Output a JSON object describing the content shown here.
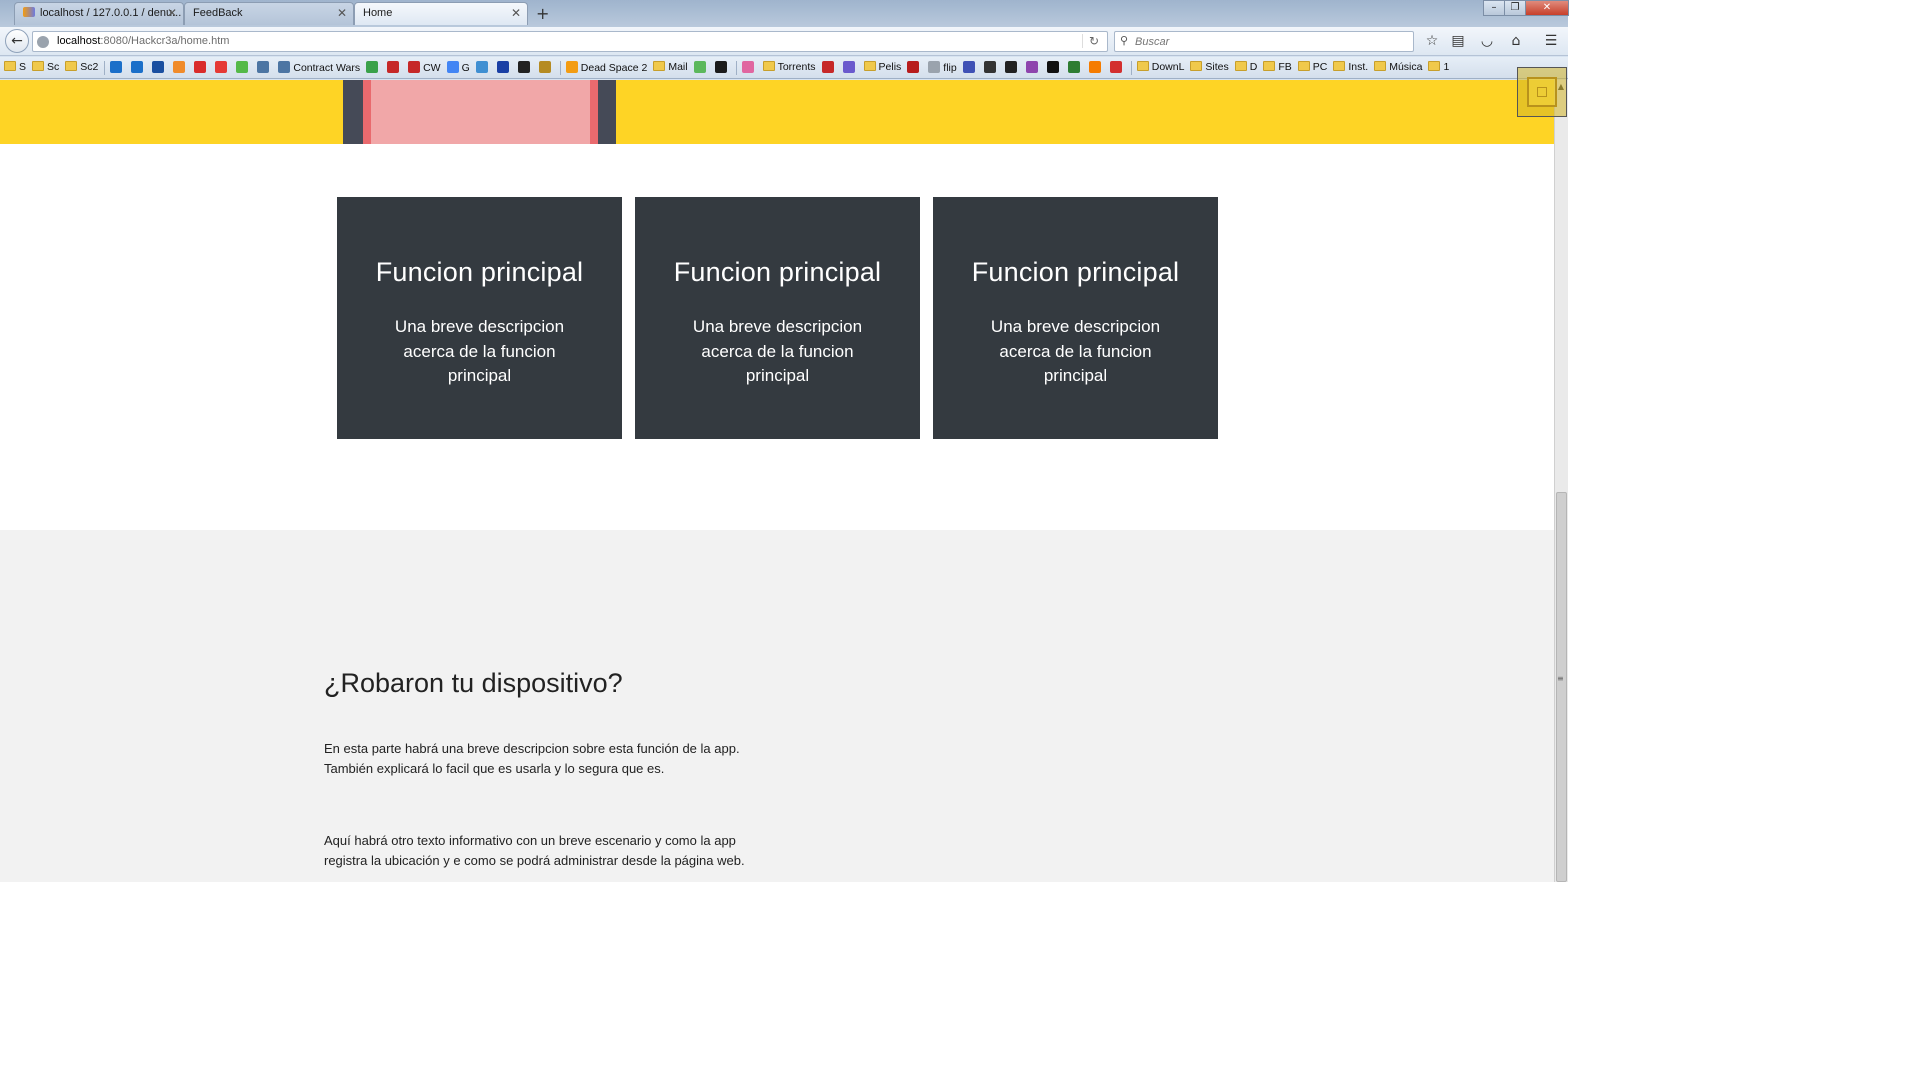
{
  "browser": {
    "tabs": [
      {
        "title": "localhost / 127.0.0.1 / denu...",
        "active": false
      },
      {
        "title": "FeedBack",
        "active": false
      },
      {
        "title": "Home",
        "active": true
      }
    ],
    "new_tab": "+",
    "window_controls": {
      "minimize": "–",
      "restore": "❐",
      "close": "✕"
    },
    "url": {
      "host": "localhost",
      "path": ":8080/Hackcr3a/home.htm"
    },
    "search_placeholder": "Buscar",
    "bookmarks": [
      {
        "label": "S",
        "kind": "folder"
      },
      {
        "label": "Sc",
        "kind": "folder"
      },
      {
        "label": "Sc2",
        "kind": "folder"
      },
      {
        "label": "",
        "kind": "sep"
      },
      {
        "label": "",
        "kind": "icon",
        "color": "#1b6fc9",
        "icon": "ti-icon"
      },
      {
        "label": "",
        "kind": "icon",
        "color": "#1b6fc9",
        "icon": "t-icon"
      },
      {
        "label": "",
        "kind": "icon",
        "color": "#1a4fa0",
        "icon": "d-icon"
      },
      {
        "label": "",
        "kind": "icon",
        "color": "#f08b2a",
        "icon": "cloud-icon"
      },
      {
        "label": "",
        "kind": "icon",
        "color": "#d92b2b",
        "icon": "youtube-icon"
      },
      {
        "label": "",
        "kind": "icon",
        "color": "#e53935",
        "icon": "cross-icon"
      },
      {
        "label": "",
        "kind": "icon",
        "color": "#54b948",
        "icon": "m-icon"
      },
      {
        "label": "",
        "kind": "icon",
        "color": "#4c75a3",
        "icon": "vk-icon"
      },
      {
        "label": "Contract Wars",
        "kind": "icon",
        "color": "#4c75a3",
        "icon": "vk-icon"
      },
      {
        "label": "",
        "kind": "icon",
        "color": "#3aa14a",
        "icon": "grid-icon"
      },
      {
        "label": "",
        "kind": "icon",
        "color": "#c62828",
        "icon": "k-icon"
      },
      {
        "label": "CW",
        "kind": "icon",
        "color": "#c62828",
        "icon": "k-icon"
      },
      {
        "label": "G",
        "kind": "icon",
        "color": "#4285f4",
        "icon": "google-icon"
      },
      {
        "label": "",
        "kind": "icon",
        "color": "#3f8fd2",
        "icon": "swirl-icon"
      },
      {
        "label": "",
        "kind": "icon",
        "color": "#1a3fa5",
        "icon": "s-icon"
      },
      {
        "label": "",
        "kind": "icon",
        "color": "#222222",
        "icon": "paw-icon"
      },
      {
        "label": "",
        "kind": "icon",
        "color": "#b58b22",
        "icon": "n-icon"
      },
      {
        "label": "",
        "kind": "sep"
      },
      {
        "label": "Dead Space 2",
        "kind": "icon",
        "color": "#f39c12",
        "icon": "info-icon"
      },
      {
        "label": "Mail",
        "kind": "folder"
      },
      {
        "label": "",
        "kind": "icon",
        "color": "#5cb85c",
        "icon": "m-icon"
      },
      {
        "label": "",
        "kind": "icon",
        "color": "#1b1b1b",
        "icon": "circle-icon"
      },
      {
        "label": "",
        "kind": "sep"
      },
      {
        "label": "",
        "kind": "icon",
        "color": "#e066a0",
        "icon": "flower-icon"
      },
      {
        "label": "Torrents",
        "kind": "folder"
      },
      {
        "label": "",
        "kind": "icon",
        "color": "#c62828",
        "icon": "z-icon"
      },
      {
        "label": "",
        "kind": "icon",
        "color": "#6a5acd",
        "icon": "hz-icon"
      },
      {
        "label": "Pelis",
        "kind": "folder"
      },
      {
        "label": "",
        "kind": "icon",
        "color": "#b71c1c",
        "icon": "poster-icon"
      },
      {
        "label": "flip",
        "kind": "icon",
        "color": "#9aa3ad",
        "icon": "globe-icon"
      },
      {
        "label": "",
        "kind": "icon",
        "color": "#3f51b5",
        "icon": "tv-icon"
      },
      {
        "label": "",
        "kind": "icon",
        "color": "#333333",
        "icon": "eye-icon"
      },
      {
        "label": "",
        "kind": "icon",
        "color": "#222222",
        "icon": "box-icon"
      },
      {
        "label": "",
        "kind": "icon",
        "color": "#8e44ad",
        "icon": "guitar-icon"
      },
      {
        "label": "",
        "kind": "icon",
        "color": "#111111",
        "icon": "ml-icon"
      },
      {
        "label": "",
        "kind": "icon",
        "color": "#2e7d32",
        "icon": "e-icon"
      },
      {
        "label": "",
        "kind": "icon",
        "color": "#f57c00",
        "icon": "blogger-icon"
      },
      {
        "label": "",
        "kind": "icon",
        "color": "#d32f2f",
        "icon": "lastpass-icon"
      },
      {
        "label": "",
        "kind": "sep"
      },
      {
        "label": "DownL",
        "kind": "folder"
      },
      {
        "label": "Sites",
        "kind": "folder"
      },
      {
        "label": "D",
        "kind": "folder"
      },
      {
        "label": "FB",
        "kind": "folder"
      },
      {
        "label": "PC",
        "kind": "folder"
      },
      {
        "label": "Inst.",
        "kind": "folder"
      },
      {
        "label": "Música",
        "kind": "folder"
      },
      {
        "label": "1",
        "kind": "folder"
      }
    ]
  },
  "colors": {
    "hero_yellow": "#fed425",
    "card_bg": "#343a40",
    "section_bg": "#f2f2f2"
  },
  "features": [
    {
      "title": "Funcion principal",
      "description": "Una breve descripcion acerca de la funcion principal"
    },
    {
      "title": "Funcion principal",
      "description": "Una breve descripcion acerca de la funcion principal"
    },
    {
      "title": "Funcion principal",
      "description": "Una breve descripcion acerca de la funcion principal"
    }
  ],
  "info_section": {
    "heading": "¿Robaron tu dispositivo?",
    "paragraphs": [
      "En esta parte habrá una breve descripcion sobre esta función de la app. También explicará lo facil que es usarla y lo segura que es.",
      "Aquí habrá otro texto informativo con un breve escenario y como la app registra la ubicación y e como se podrá administrar desde la página web."
    ]
  }
}
